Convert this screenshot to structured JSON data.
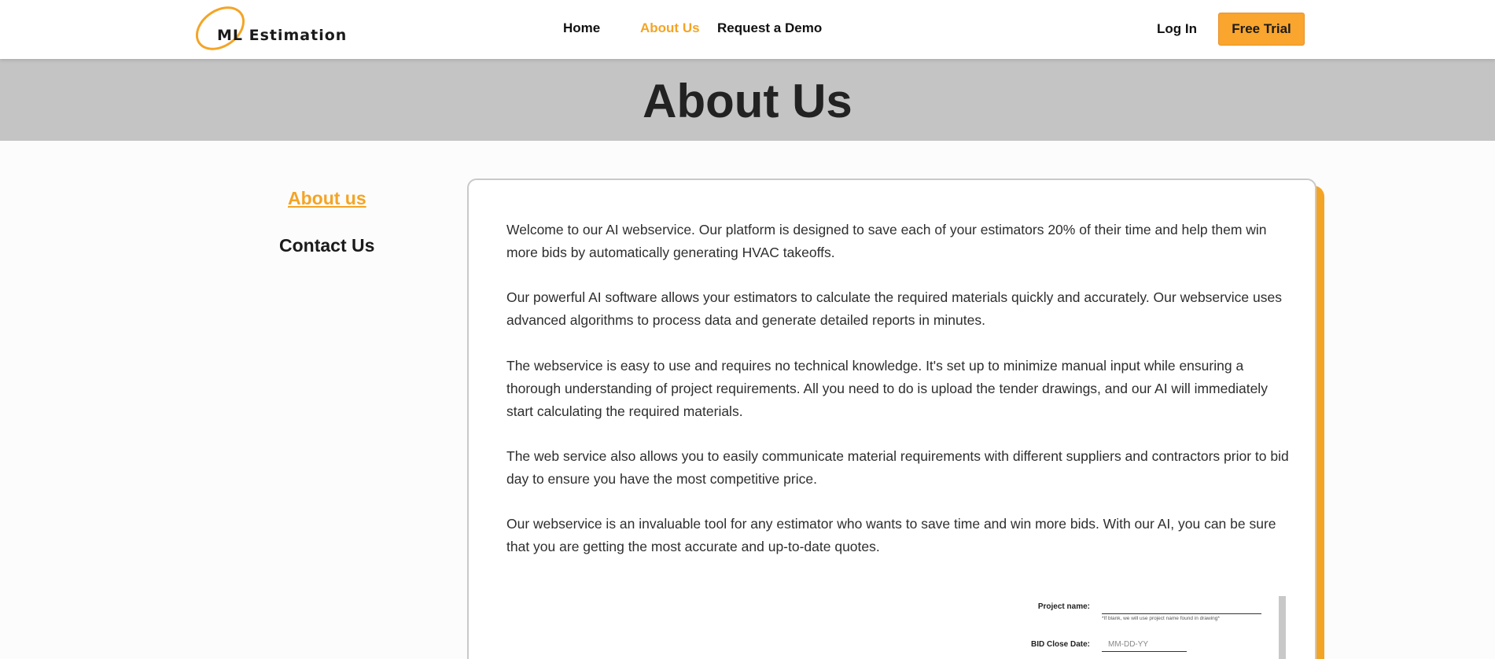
{
  "header": {
    "logo_text": "ML Estimation",
    "nav": {
      "home": "Home",
      "about": "About Us",
      "demo": "Request a Demo"
    },
    "login": "Log In",
    "free_trial": "Free Trial"
  },
  "banner": {
    "title": "About Us"
  },
  "sidebar": {
    "about": "About us",
    "contact": "Contact Us"
  },
  "content": {
    "paragraphs": [
      "Welcome to our AI webservice. Our platform is designed to save each of your estimators 20% of their time and help them win more bids by automatically generating HVAC takeoffs.",
      "Our powerful AI software allows your estimators to calculate the required materials quickly and accurately. Our webservice uses advanced algorithms to process data and generate detailed reports in minutes.",
      "The webservice is easy to use and requires no technical knowledge. It's set up to minimize manual input while ensuring a thorough understanding of project requirements. All you need to do is upload the tender drawings, and our AI will immediately start calculating the required materials.",
      "The web service also allows you to easily communicate material requirements with different suppliers and contractors prior to bid day to ensure you have the most competitive price.",
      "Our webservice is an invaluable tool for any estimator who wants to save time and win more bids. With our AI, you can be sure that you are getting the most accurate and up-to-date quotes."
    ]
  },
  "form_preview": {
    "project_name_label": "Project name:",
    "project_name_hint": "*If blank, we will use project name found in drawing*",
    "bid_close_label": "BID Close Date:",
    "bid_close_placeholder": "MM-DD-YY"
  },
  "colors": {
    "accent": "#f4a425",
    "banner": "#c4c4c4",
    "text": "#222222"
  }
}
